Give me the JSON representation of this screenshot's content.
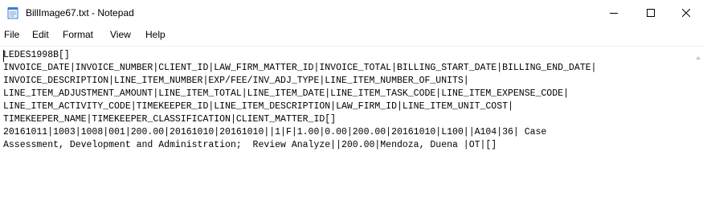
{
  "window": {
    "title": "BillImage67.txt - Notepad",
    "icon": "notepad-icon",
    "controls": {
      "minimize_icon": "minimize-icon",
      "maximize_icon": "maximize-icon",
      "close_icon": "close-icon"
    }
  },
  "menu": {
    "file": "File",
    "edit": "Edit",
    "format": "Format",
    "view": "View",
    "help": "Help"
  },
  "document": {
    "lines": [
      "LEDES1998B[]",
      "INVOICE_DATE|INVOICE_NUMBER|CLIENT_ID|LAW_FIRM_MATTER_ID|INVOICE_TOTAL|BILLING_START_DATE|BILLING_END_DATE|",
      "INVOICE_DESCRIPTION|LINE_ITEM_NUMBER|EXP/FEE/INV_ADJ_TYPE|LINE_ITEM_NUMBER_OF_UNITS|",
      "LINE_ITEM_ADJUSTMENT_AMOUNT|LINE_ITEM_TOTAL|LINE_ITEM_DATE|LINE_ITEM_TASK_CODE|LINE_ITEM_EXPENSE_CODE|",
      "LINE_ITEM_ACTIVITY_CODE|TIMEKEEPER_ID|LINE_ITEM_DESCRIPTION|LAW_FIRM_ID|LINE_ITEM_UNIT_COST|",
      "TIMEKEEPER_NAME|TIMEKEEPER_CLASSIFICATION|CLIENT_MATTER_ID[]",
      "20161011|1003|1008|001|200.00|20161010|20161010||1|F|1.00|0.00|200.00|20161010|L100||A104|36| Case",
      "Assessment, Development and Administration;  Review Analyze||200.00|Mendoza, Duena |OT|[]"
    ]
  },
  "colors": {
    "background": "#ffffff",
    "text": "#000000",
    "notepad_icon_blue": "#3b7dd8"
  }
}
